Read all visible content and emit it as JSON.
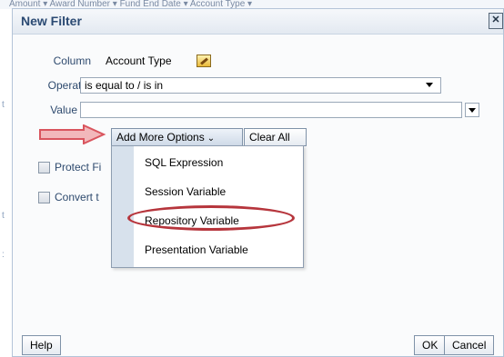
{
  "background": {
    "strip_text": "Amount  ▾  Award Number  ▾  Fund End Date  ▾  Account Type ▾"
  },
  "dialog": {
    "title": "New Filter",
    "close_label": "✕"
  },
  "form": {
    "column_label": "Column",
    "column_value": "Account Type",
    "operator_label": "Operator",
    "operator_value": "is equal to / is in",
    "value_label": "Value",
    "value_text": ""
  },
  "toolbar": {
    "add_more_label": "Add More Options",
    "clear_all_label": "Clear All"
  },
  "checkboxes": {
    "protect_label": "Protect Fi",
    "convert_label": "Convert t"
  },
  "menu": {
    "items": [
      {
        "label": "SQL Expression"
      },
      {
        "label": "Session Variable"
      },
      {
        "label": "Repository Variable"
      },
      {
        "label": "Presentation Variable"
      }
    ]
  },
  "footer": {
    "help_label": "Help",
    "ok_label": "OK",
    "cancel_label": "Cancel"
  },
  "colors": {
    "arrow": "#d9555e",
    "highlight_oval": "#b6353c",
    "title_text": "#2b4a73"
  }
}
